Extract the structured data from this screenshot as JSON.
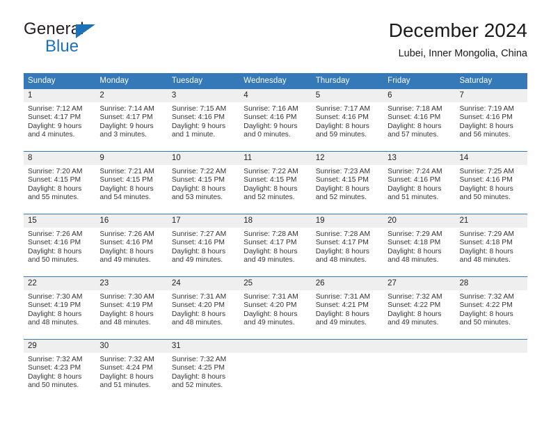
{
  "brand": {
    "name_part1": "General",
    "name_part2": "Blue",
    "triangle_color": "#1b72b8"
  },
  "header": {
    "title": "December 2024",
    "subtitle": "Lubei, Inner Mongolia, China"
  },
  "theme": {
    "header_bg": "#3579b8",
    "daynum_bg": "#efefef",
    "text": "#222222"
  },
  "weekday_headers": [
    "Sunday",
    "Monday",
    "Tuesday",
    "Wednesday",
    "Thursday",
    "Friday",
    "Saturday"
  ],
  "weeks": [
    [
      {
        "day": "1",
        "sunrise": "Sunrise: 7:12 AM",
        "sunset": "Sunset: 4:17 PM",
        "daylight_line1": "Daylight: 9 hours",
        "daylight_line2": "and 4 minutes."
      },
      {
        "day": "2",
        "sunrise": "Sunrise: 7:14 AM",
        "sunset": "Sunset: 4:17 PM",
        "daylight_line1": "Daylight: 9 hours",
        "daylight_line2": "and 3 minutes."
      },
      {
        "day": "3",
        "sunrise": "Sunrise: 7:15 AM",
        "sunset": "Sunset: 4:16 PM",
        "daylight_line1": "Daylight: 9 hours",
        "daylight_line2": "and 1 minute."
      },
      {
        "day": "4",
        "sunrise": "Sunrise: 7:16 AM",
        "sunset": "Sunset: 4:16 PM",
        "daylight_line1": "Daylight: 9 hours",
        "daylight_line2": "and 0 minutes."
      },
      {
        "day": "5",
        "sunrise": "Sunrise: 7:17 AM",
        "sunset": "Sunset: 4:16 PM",
        "daylight_line1": "Daylight: 8 hours",
        "daylight_line2": "and 59 minutes."
      },
      {
        "day": "6",
        "sunrise": "Sunrise: 7:18 AM",
        "sunset": "Sunset: 4:16 PM",
        "daylight_line1": "Daylight: 8 hours",
        "daylight_line2": "and 57 minutes."
      },
      {
        "day": "7",
        "sunrise": "Sunrise: 7:19 AM",
        "sunset": "Sunset: 4:16 PM",
        "daylight_line1": "Daylight: 8 hours",
        "daylight_line2": "and 56 minutes."
      }
    ],
    [
      {
        "day": "8",
        "sunrise": "Sunrise: 7:20 AM",
        "sunset": "Sunset: 4:15 PM",
        "daylight_line1": "Daylight: 8 hours",
        "daylight_line2": "and 55 minutes."
      },
      {
        "day": "9",
        "sunrise": "Sunrise: 7:21 AM",
        "sunset": "Sunset: 4:15 PM",
        "daylight_line1": "Daylight: 8 hours",
        "daylight_line2": "and 54 minutes."
      },
      {
        "day": "10",
        "sunrise": "Sunrise: 7:22 AM",
        "sunset": "Sunset: 4:15 PM",
        "daylight_line1": "Daylight: 8 hours",
        "daylight_line2": "and 53 minutes."
      },
      {
        "day": "11",
        "sunrise": "Sunrise: 7:22 AM",
        "sunset": "Sunset: 4:15 PM",
        "daylight_line1": "Daylight: 8 hours",
        "daylight_line2": "and 52 minutes."
      },
      {
        "day": "12",
        "sunrise": "Sunrise: 7:23 AM",
        "sunset": "Sunset: 4:15 PM",
        "daylight_line1": "Daylight: 8 hours",
        "daylight_line2": "and 52 minutes."
      },
      {
        "day": "13",
        "sunrise": "Sunrise: 7:24 AM",
        "sunset": "Sunset: 4:16 PM",
        "daylight_line1": "Daylight: 8 hours",
        "daylight_line2": "and 51 minutes."
      },
      {
        "day": "14",
        "sunrise": "Sunrise: 7:25 AM",
        "sunset": "Sunset: 4:16 PM",
        "daylight_line1": "Daylight: 8 hours",
        "daylight_line2": "and 50 minutes."
      }
    ],
    [
      {
        "day": "15",
        "sunrise": "Sunrise: 7:26 AM",
        "sunset": "Sunset: 4:16 PM",
        "daylight_line1": "Daylight: 8 hours",
        "daylight_line2": "and 50 minutes."
      },
      {
        "day": "16",
        "sunrise": "Sunrise: 7:26 AM",
        "sunset": "Sunset: 4:16 PM",
        "daylight_line1": "Daylight: 8 hours",
        "daylight_line2": "and 49 minutes."
      },
      {
        "day": "17",
        "sunrise": "Sunrise: 7:27 AM",
        "sunset": "Sunset: 4:16 PM",
        "daylight_line1": "Daylight: 8 hours",
        "daylight_line2": "and 49 minutes."
      },
      {
        "day": "18",
        "sunrise": "Sunrise: 7:28 AM",
        "sunset": "Sunset: 4:17 PM",
        "daylight_line1": "Daylight: 8 hours",
        "daylight_line2": "and 49 minutes."
      },
      {
        "day": "19",
        "sunrise": "Sunrise: 7:28 AM",
        "sunset": "Sunset: 4:17 PM",
        "daylight_line1": "Daylight: 8 hours",
        "daylight_line2": "and 48 minutes."
      },
      {
        "day": "20",
        "sunrise": "Sunrise: 7:29 AM",
        "sunset": "Sunset: 4:18 PM",
        "daylight_line1": "Daylight: 8 hours",
        "daylight_line2": "and 48 minutes."
      },
      {
        "day": "21",
        "sunrise": "Sunrise: 7:29 AM",
        "sunset": "Sunset: 4:18 PM",
        "daylight_line1": "Daylight: 8 hours",
        "daylight_line2": "and 48 minutes."
      }
    ],
    [
      {
        "day": "22",
        "sunrise": "Sunrise: 7:30 AM",
        "sunset": "Sunset: 4:19 PM",
        "daylight_line1": "Daylight: 8 hours",
        "daylight_line2": "and 48 minutes."
      },
      {
        "day": "23",
        "sunrise": "Sunrise: 7:30 AM",
        "sunset": "Sunset: 4:19 PM",
        "daylight_line1": "Daylight: 8 hours",
        "daylight_line2": "and 48 minutes."
      },
      {
        "day": "24",
        "sunrise": "Sunrise: 7:31 AM",
        "sunset": "Sunset: 4:20 PM",
        "daylight_line1": "Daylight: 8 hours",
        "daylight_line2": "and 48 minutes."
      },
      {
        "day": "25",
        "sunrise": "Sunrise: 7:31 AM",
        "sunset": "Sunset: 4:20 PM",
        "daylight_line1": "Daylight: 8 hours",
        "daylight_line2": "and 49 minutes."
      },
      {
        "day": "26",
        "sunrise": "Sunrise: 7:31 AM",
        "sunset": "Sunset: 4:21 PM",
        "daylight_line1": "Daylight: 8 hours",
        "daylight_line2": "and 49 minutes."
      },
      {
        "day": "27",
        "sunrise": "Sunrise: 7:32 AM",
        "sunset": "Sunset: 4:22 PM",
        "daylight_line1": "Daylight: 8 hours",
        "daylight_line2": "and 49 minutes."
      },
      {
        "day": "28",
        "sunrise": "Sunrise: 7:32 AM",
        "sunset": "Sunset: 4:22 PM",
        "daylight_line1": "Daylight: 8 hours",
        "daylight_line2": "and 50 minutes."
      }
    ],
    [
      {
        "day": "29",
        "sunrise": "Sunrise: 7:32 AM",
        "sunset": "Sunset: 4:23 PM",
        "daylight_line1": "Daylight: 8 hours",
        "daylight_line2": "and 50 minutes."
      },
      {
        "day": "30",
        "sunrise": "Sunrise: 7:32 AM",
        "sunset": "Sunset: 4:24 PM",
        "daylight_line1": "Daylight: 8 hours",
        "daylight_line2": "and 51 minutes."
      },
      {
        "day": "31",
        "sunrise": "Sunrise: 7:32 AM",
        "sunset": "Sunset: 4:25 PM",
        "daylight_line1": "Daylight: 8 hours",
        "daylight_line2": "and 52 minutes."
      },
      {
        "day": "",
        "sunrise": "",
        "sunset": "",
        "daylight_line1": "",
        "daylight_line2": ""
      },
      {
        "day": "",
        "sunrise": "",
        "sunset": "",
        "daylight_line1": "",
        "daylight_line2": ""
      },
      {
        "day": "",
        "sunrise": "",
        "sunset": "",
        "daylight_line1": "",
        "daylight_line2": ""
      },
      {
        "day": "",
        "sunrise": "",
        "sunset": "",
        "daylight_line1": "",
        "daylight_line2": ""
      }
    ]
  ]
}
